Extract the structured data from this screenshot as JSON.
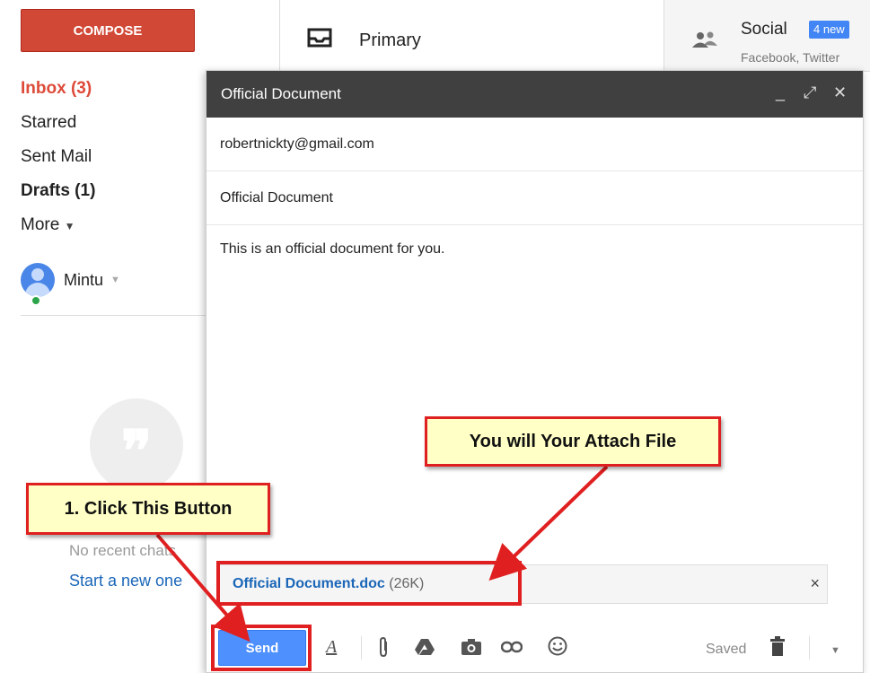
{
  "sidebar": {
    "compose_label": "COMPOSE",
    "items": [
      {
        "label": "Inbox (3)"
      },
      {
        "label": "Starred"
      },
      {
        "label": "Sent Mail"
      },
      {
        "label": "Drafts (1)"
      },
      {
        "label": "More"
      }
    ],
    "user": {
      "name": "Mintu"
    },
    "hangouts": {
      "no_chats": "No recent chats",
      "start_new": "Start a new one"
    }
  },
  "tabs": {
    "primary": {
      "label": "Primary",
      "icon": "inbox-icon"
    },
    "social": {
      "label": "Social",
      "badge": "4 new",
      "subtitle": "Facebook, Twitter",
      "icon": "people-icon"
    }
  },
  "compose": {
    "title": "Official Document",
    "to": "robertnickty@gmail.com",
    "subject": "Official Document",
    "body": "This is an official document for you.",
    "attachment": {
      "name": "Official Document.doc",
      "size": "(26K)"
    },
    "send_label": "Send",
    "saved_label": "Saved"
  },
  "annotations": {
    "attach_callout": "You will Your Attach File",
    "click_callout": "1. Click This Button"
  },
  "colors": {
    "compose_red": "#d14836",
    "send_blue": "#4d90fe",
    "header_dark": "#404040",
    "callout_bg": "#ffffc6",
    "annotation_red": "#e02020",
    "link_blue": "#1a66b8"
  }
}
